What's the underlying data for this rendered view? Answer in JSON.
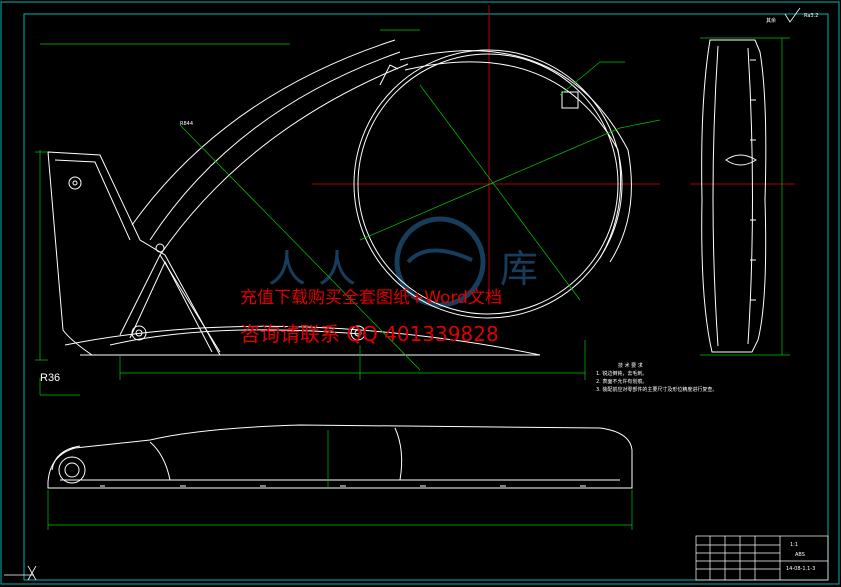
{
  "watermark": {
    "line1": "充值下载购买全套图纸+Word文档",
    "line2": "咨询请联系  QQ 401339828",
    "logo_text": "人人文库"
  },
  "labels": {
    "r36": "R36",
    "r844": "R844",
    "roughness": "其余",
    "roughness_value": "Ra3.2"
  },
  "tech_notes": {
    "title": "技 术 要 求",
    "items": [
      "1. 锐边倒钝，去毛刺。",
      "2. 表面不允许有划痕。",
      "3. 装配前应对零部件的主要尺寸及形位精度进行复查。"
    ]
  },
  "title_block": {
    "scale": "1:1",
    "material": "ABS",
    "drawing_no": "14-08-1.1-3"
  },
  "colors": {
    "background": "#000000",
    "outline": "#ffffff",
    "dimension": "#00c800",
    "centerline": "#e00000",
    "frame": "#00b4b4",
    "watermark": "#e00000",
    "logo": "#2a6fa8"
  }
}
